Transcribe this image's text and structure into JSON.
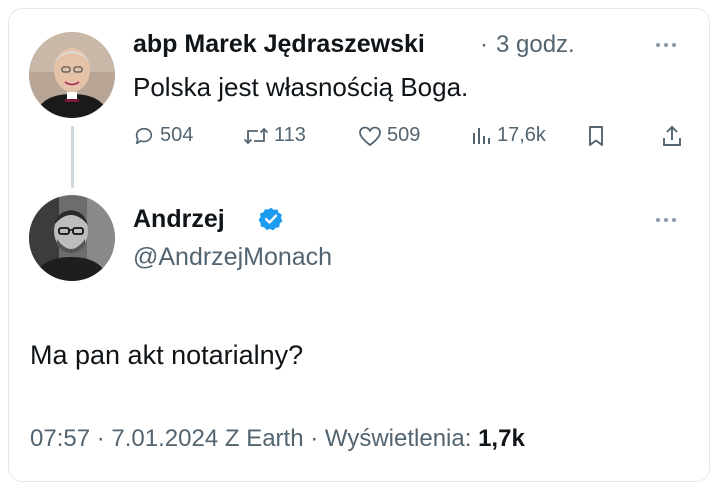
{
  "tweet1": {
    "author": "abp Marek Jędraszewski",
    "separator": "·",
    "time": "3 godz.",
    "text": "Polska jest własnością Boga.",
    "stats": {
      "replies": "504",
      "reposts": "113",
      "likes": "509",
      "views": "17,6k"
    },
    "icons": [
      "reply-icon",
      "repost-icon",
      "like-icon",
      "views-icon",
      "bookmark-icon",
      "share-icon",
      "more-icon"
    ]
  },
  "tweet2": {
    "name": "Andrzej",
    "handle": "@AndrzejMonach",
    "text": "Ma pan akt notarialny?",
    "footer": {
      "time": "07:57",
      "sep1": "·",
      "date": "7.01.2024",
      "source": "Z Earth",
      "sep2": "·",
      "views_label": "Wyświetlenia:",
      "views_value": "1,7k"
    },
    "icons": [
      "verified-badge-icon",
      "more-icon"
    ]
  },
  "colors": {
    "text": "#0f1419",
    "muted": "#536471",
    "verified": "#1d9bf0",
    "thread_line": "#cfd9de"
  }
}
